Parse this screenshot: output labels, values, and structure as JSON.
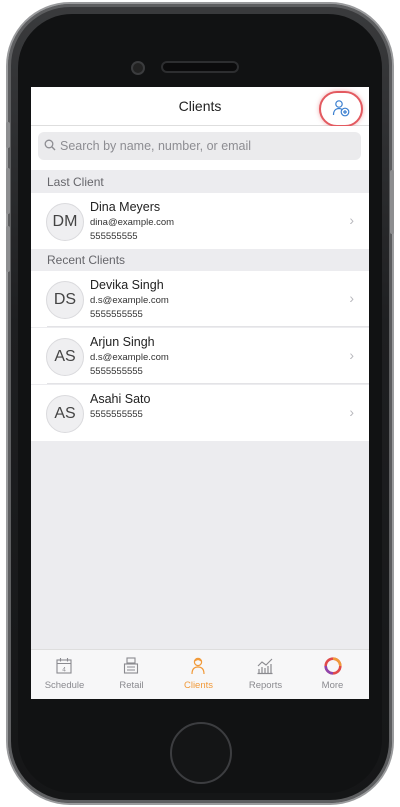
{
  "navbar": {
    "title": "Clients"
  },
  "search": {
    "placeholder": "Search by name, number, or email"
  },
  "sections": {
    "last_client": "Last Client",
    "recent_clients": "Recent Clients"
  },
  "last_client": {
    "initials": "DM",
    "name": "Dina Meyers",
    "email": "dina@example.com",
    "phone": "555555555"
  },
  "recent_clients": [
    {
      "initials": "DS",
      "name": "Devika Singh",
      "email": "d.s@example.com",
      "phone": "5555555555"
    },
    {
      "initials": "AS",
      "name": "Arjun Singh",
      "email": "d.s@example.com",
      "phone": "5555555555"
    },
    {
      "initials": "AS",
      "name": "Asahi Sato",
      "phone": "5555555555"
    }
  ],
  "tabs": [
    {
      "label": "Schedule",
      "icon": "calendar-icon"
    },
    {
      "label": "Retail",
      "icon": "register-icon"
    },
    {
      "label": "Clients",
      "icon": "person-icon",
      "active": true
    },
    {
      "label": "Reports",
      "icon": "chart-icon"
    },
    {
      "label": "More",
      "icon": "ring-logo-icon"
    }
  ],
  "colors": {
    "accent": "#f19a3a",
    "highlight": "#e35a60",
    "tab_inactive": "#8a8a8f",
    "background": "#ececef"
  }
}
